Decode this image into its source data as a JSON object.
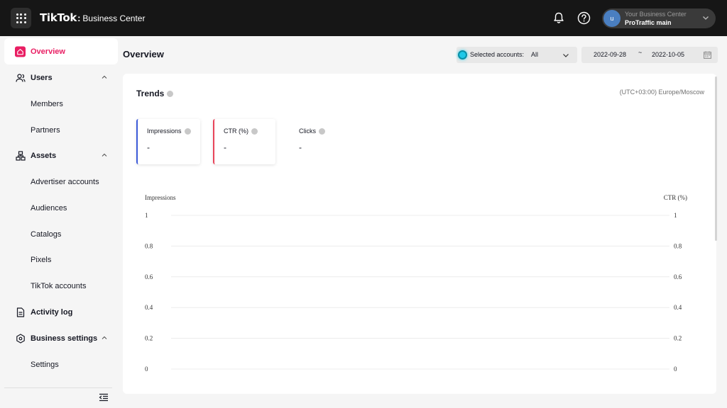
{
  "topbar": {
    "brand": "TikTok",
    "brand_sub": "Business Center",
    "account": {
      "avatar_letter": "u",
      "line1": "Your Business Center",
      "line2": "ProTraffic main"
    }
  },
  "sidebar": {
    "items": [
      {
        "label": "Overview",
        "icon": "home-icon",
        "active": true
      },
      {
        "label": "Users",
        "icon": "users-icon",
        "group": true
      },
      {
        "label": "Members"
      },
      {
        "label": "Partners"
      },
      {
        "label": "Assets",
        "icon": "assets-icon",
        "group": true
      },
      {
        "label": "Advertiser accounts"
      },
      {
        "label": "Audiences"
      },
      {
        "label": "Catalogs"
      },
      {
        "label": "Pixels"
      },
      {
        "label": "TikTok accounts"
      },
      {
        "label": "Activity log",
        "icon": "document-icon",
        "group": true
      },
      {
        "label": "Business settings",
        "icon": "settings-icon",
        "group": true
      },
      {
        "label": "Settings"
      }
    ]
  },
  "header": {
    "title": "Overview",
    "accounts_label": "Selected accounts:",
    "accounts_value": "All",
    "date_start": "2022-09-28",
    "date_sep": "~",
    "date_end": "2022-10-05"
  },
  "trends": {
    "title": "Trends",
    "timezone": "(UTC+03:00) Europe/Moscow",
    "metrics": [
      {
        "label": "Impressions",
        "value": "-",
        "accent": "#3d5bd9"
      },
      {
        "label": "CTR (%)",
        "value": "-",
        "accent": "#e8445a"
      },
      {
        "label": "Clicks",
        "value": "-"
      }
    ]
  },
  "chart_data": {
    "type": "line",
    "ylabel_left": "Impressions",
    "ylabel_right": "CTR (%)",
    "yticks_left": [
      "1",
      "0.8",
      "0.6",
      "0.4",
      "0.2",
      "0"
    ],
    "yticks_right": [
      "1",
      "0.8",
      "0.6",
      "0.4",
      "0.2",
      "0"
    ],
    "ylim": [
      0,
      1
    ],
    "series": [],
    "grid": true
  },
  "colors": {
    "accent": "#e91e63",
    "topbar": "#161616",
    "highlight": "#1ec8e8"
  }
}
